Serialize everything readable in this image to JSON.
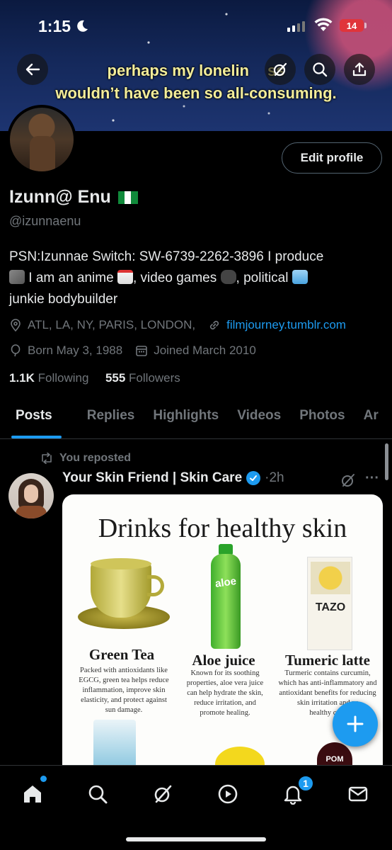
{
  "status_bar": {
    "time": "1:15",
    "battery": "14"
  },
  "banner": {
    "caption_line1": "perhaps my lonelin",
    "caption_line1_tail": "ss",
    "caption_line2": "wouldn’t have been so all-consuming."
  },
  "profile": {
    "edit_label": "Edit profile",
    "name": "Izunn@ Enu",
    "handle": "@izunnaenu",
    "bio_line1": "PSN:Izunnae Switch: SW-6739-2262-3896 I produce",
    "bio_line2a": " I am an anime ",
    "bio_line2b": ", video games ",
    "bio_line2c": ", political ",
    "bio_line3": "junkie bodybuilder",
    "location": "ATL, LA, NY, PARIS, LONDON,",
    "website": "filmjourney.tumblr.com",
    "born": "Born May 3, 1988",
    "joined": "Joined March 2010",
    "following_count": "1.1K",
    "following_label": "Following",
    "followers_count": "555",
    "followers_label": "Followers"
  },
  "tabs": [
    "Posts",
    "Replies",
    "Highlights",
    "Videos",
    "Photos",
    "Ar"
  ],
  "post": {
    "repost_label": "You reposted",
    "author": "Your Skin Friend | Skin Care",
    "time": "2h",
    "more": "···",
    "image": {
      "title": "Drinks for healthy skin",
      "drinks": [
        {
          "name": "Green Tea",
          "desc": [
            "Packed with antioxidants like",
            "EGCG, green tea helps reduce",
            "inflammation, improve skin",
            "elasticity, and protect against",
            "sun damage."
          ]
        },
        {
          "name": "Aloe juice",
          "desc": [
            "Known for its soothing",
            "properties, aloe vera juice",
            "can help hydrate the skin,",
            "reduce irritation, and",
            "promote healing."
          ]
        },
        {
          "name": "Tumeric latte",
          "desc": [
            "Turmeric contains curcumin,",
            "which has anti-inflammatory and",
            "antioxidant benefits for reducing",
            "skin irritation and pr",
            "healthy com"
          ]
        }
      ],
      "aloe_label": "aloe",
      "tazo_label": "TAZO",
      "pom_label": "POM"
    }
  },
  "nav": {
    "notifications_badge": "1"
  },
  "colors": {
    "accent": "#1d9bf0",
    "muted": "#71767b",
    "text": "#e7e9ea",
    "background": "#000000"
  }
}
